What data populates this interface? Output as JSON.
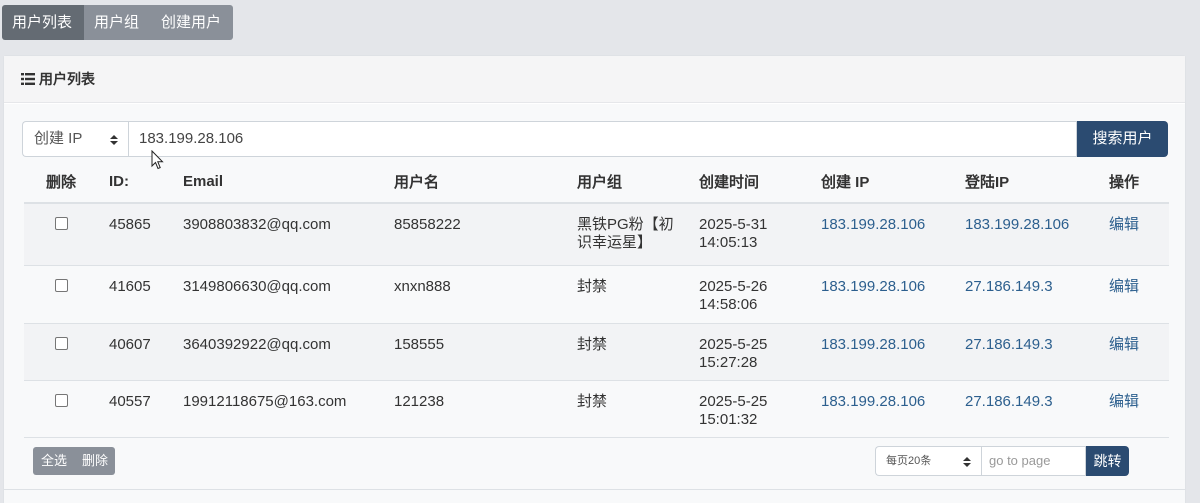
{
  "tabs": [
    {
      "label": "用户列表",
      "active": true
    },
    {
      "label": "用户组"
    },
    {
      "label": "创建用户"
    }
  ],
  "panel": {
    "title": "用户列表",
    "title_icon": "list-icon"
  },
  "search": {
    "field_select": "创建 IP",
    "value": "183.199.28.106",
    "button_label": "搜索用户"
  },
  "table": {
    "headers": [
      "删除",
      "ID:",
      "Email",
      "用户名",
      "用户组",
      "创建时间",
      "创建 IP",
      "登陆IP",
      "操作"
    ],
    "rows": [
      {
        "id": "45865",
        "email": "3908803832@qq.com",
        "username": "85858222",
        "group_l1": "黑铁PG粉【初",
        "group_l2": "识幸运星】",
        "date": "2025-5-31",
        "time": "14:05:13",
        "create_ip": "183.199.28.106",
        "login_ip": "183.199.28.106",
        "action": "编辑"
      },
      {
        "id": "41605",
        "email": "3149806630@qq.com",
        "username": "xnxn888",
        "group_l1": "封禁",
        "group_l2": "",
        "date": "2025-5-26",
        "time": "14:58:06",
        "create_ip": "183.199.28.106",
        "login_ip": "27.186.149.3",
        "action": "编辑"
      },
      {
        "id": "40607",
        "email": "3640392922@qq.com",
        "username": "158555",
        "group_l1": "封禁",
        "group_l2": "",
        "date": "2025-5-25",
        "time": "15:27:28",
        "create_ip": "183.199.28.106",
        "login_ip": "27.186.149.3",
        "action": "编辑"
      },
      {
        "id": "40557",
        "email": "19912118675@163.com",
        "username": "121238",
        "group_l1": "封禁",
        "group_l2": "",
        "date": "2025-5-25",
        "time": "15:01:32",
        "create_ip": "183.199.28.106",
        "login_ip": "27.186.149.3",
        "action": "编辑"
      }
    ]
  },
  "footer": {
    "select_all_label": "全选",
    "delete_label": "删除",
    "per_page_select": "每页20条",
    "goto_placeholder": "go to page",
    "jump_label": "跳转"
  },
  "colors": {
    "primary": "#2b4b71",
    "link": "#2c5f8e",
    "tab_active": "#646b73",
    "tab": "#8a9099"
  }
}
